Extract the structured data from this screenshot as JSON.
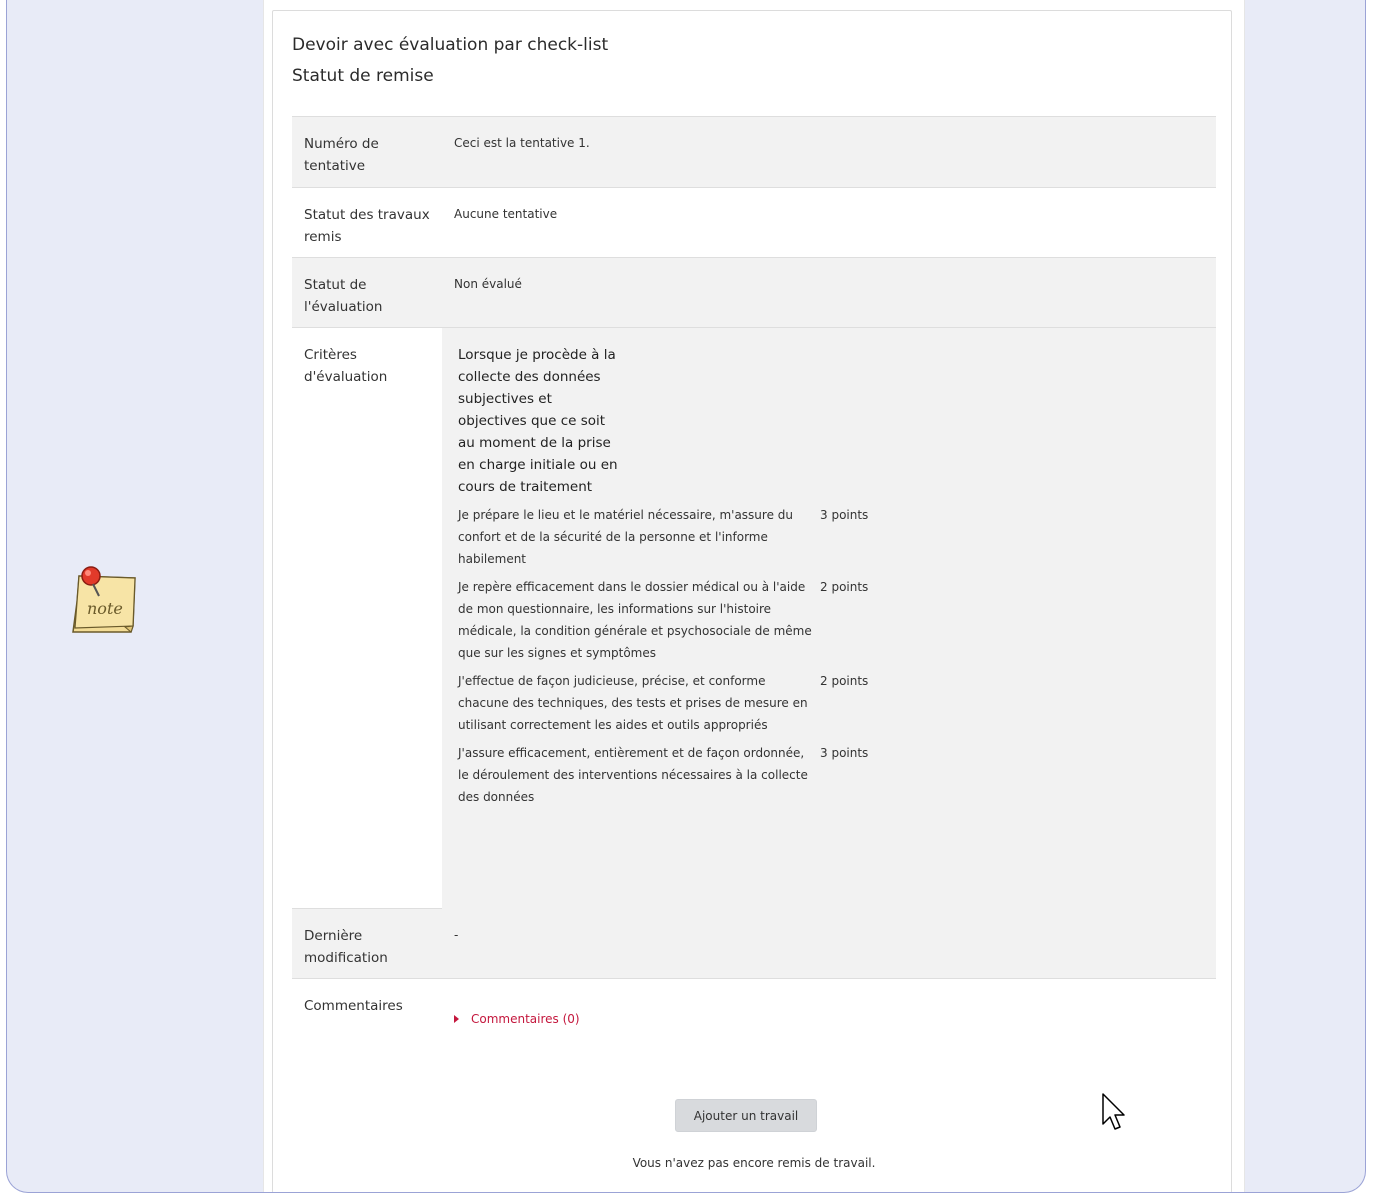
{
  "assignment": {
    "title": "Devoir avec évaluation par check-list",
    "subtitle": "Statut de remise"
  },
  "status_rows": [
    {
      "label": "Numéro de tentative",
      "value": "Ceci est la tentative 1."
    },
    {
      "label": "Statut des travaux remis",
      "value": "Aucune tentative"
    },
    {
      "label": "Statut de l'évaluation",
      "value": "Non évalué"
    }
  ],
  "criteria": {
    "label": "Critères d'évaluation",
    "heading": "Lorsque je procède à la collecte des données subjectives et objectives que ce soit au moment de la prise en charge initiale ou en cours de traitement",
    "items": [
      {
        "description": "Je prépare le lieu et le matériel nécessaire, m'assure du confort et de la sécurité de la personne et l'informe habilement",
        "points": "3 points"
      },
      {
        "description": "Je repère efficacement dans le dossier médical ou à l'aide de mon questionnaire, les informations sur l'histoire médicale, la condition générale et psychosociale de même que sur les signes et symptômes",
        "points": "2 points"
      },
      {
        "description": "J'effectue de façon judicieuse, précise, et conforme chacune des techniques, des tests et prises de mesure en utilisant correctement les aides et outils appropriés",
        "points": "2 points"
      },
      {
        "description": "J'assure efficacement, entièrement et de façon ordonnée, le déroulement des interventions nécessaires à la collecte des données",
        "points": "3 points"
      }
    ]
  },
  "last_modified": {
    "label": "Dernière modification",
    "value": "-"
  },
  "comments": {
    "label": "Commentaires",
    "link": "Commentaires (0)"
  },
  "actions": {
    "add_work": "Ajouter un travail"
  },
  "footer_message": "Vous n'avez pas encore remis de travail.",
  "icons": {
    "note": "note-icon",
    "cursor": "mouse-pointer-icon"
  },
  "colors": {
    "background": "#e8ebf7",
    "link": "#c4173d",
    "row_shade": "#f2f2f2"
  }
}
